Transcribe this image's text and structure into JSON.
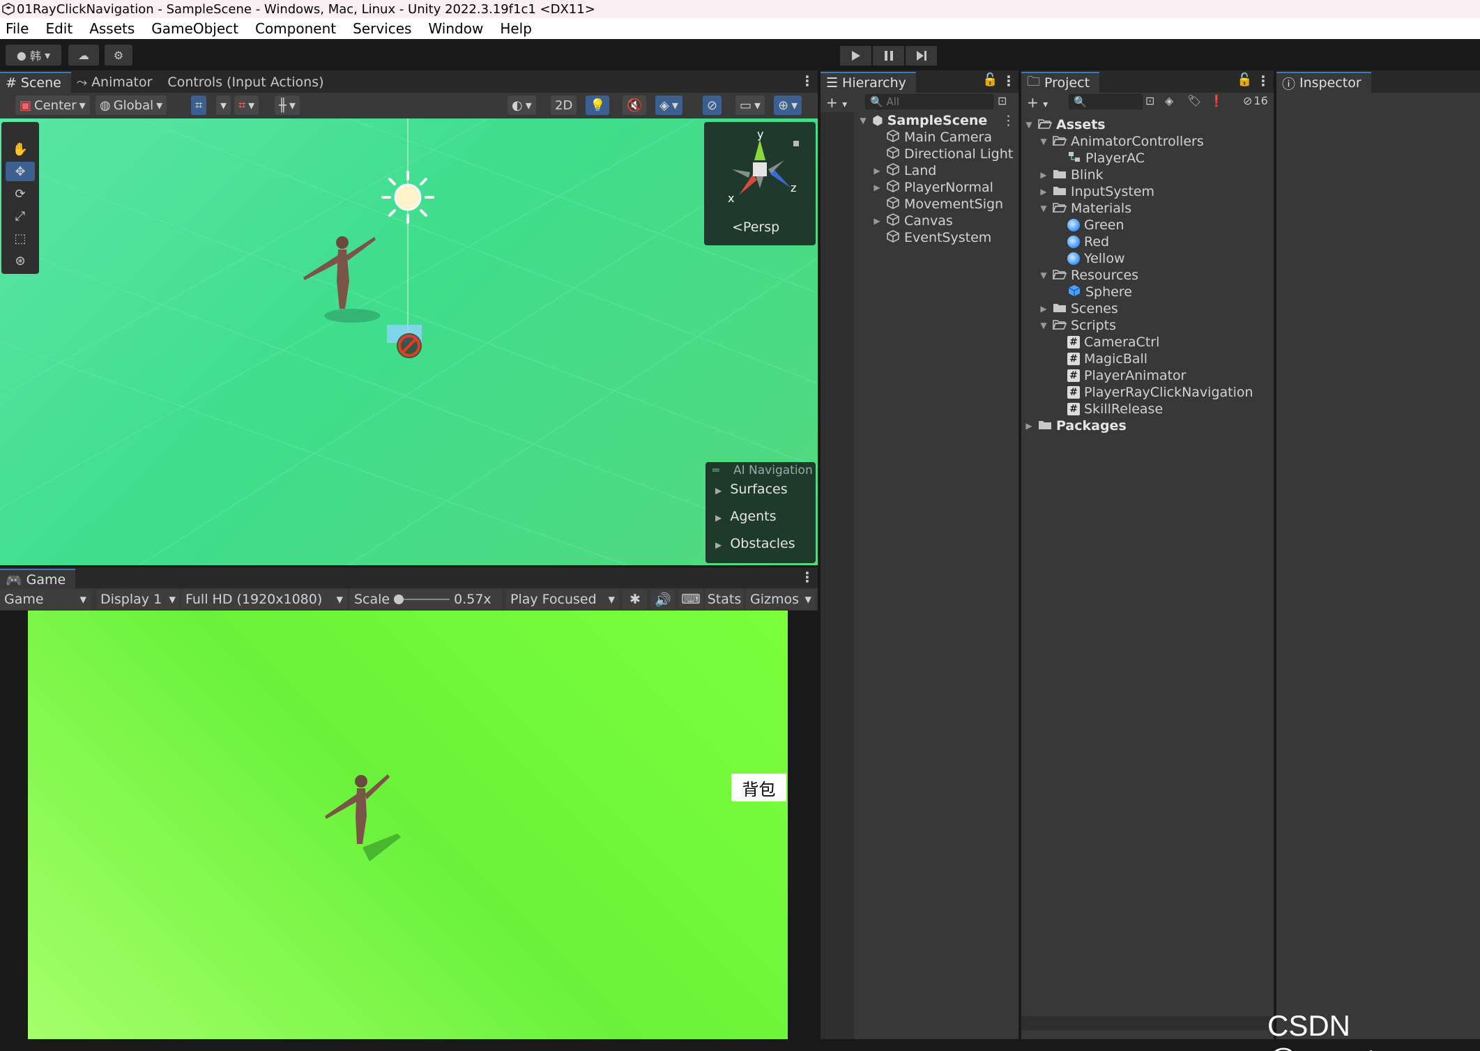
{
  "window": {
    "title": "01RayClickNavigation - SampleScene - Windows, Mac, Linux - Unity 2022.3.19f1c1 <DX11>"
  },
  "menu": [
    "File",
    "Edit",
    "Assets",
    "GameObject",
    "Component",
    "Services",
    "Window",
    "Help"
  ],
  "toolbar": {
    "account_label": "韩"
  },
  "scene_panel": {
    "tabs": [
      "Scene",
      "Animator",
      "Controls (Input Actions)"
    ],
    "pivot_mode": "Center",
    "pivot_space": "Global",
    "mode_2d": "2D",
    "gizmo": {
      "axis_y": "y",
      "axis_x": "x",
      "axis_z": "z",
      "projection": "Persp"
    },
    "ai_navigation": {
      "title": "AI Navigation",
      "items": [
        "Surfaces",
        "Agents",
        "Obstacles"
      ]
    }
  },
  "game_panel": {
    "tab": "Game",
    "view_mode": "Game",
    "display": "Display 1",
    "resolution": "Full HD (1920x1080)",
    "scale_label": "Scale",
    "scale_value": "0.57x",
    "scale_fraction": 0.0,
    "play_mode": "Play Focused",
    "stats": "Stats",
    "gizmos": "Gizmos",
    "bag_button": "背包"
  },
  "hierarchy": {
    "tab": "Hierarchy",
    "search_placeholder": "All",
    "scene": "SampleScene",
    "items": [
      {
        "name": "Main Camera",
        "expandable": false
      },
      {
        "name": "Directional Light",
        "expandable": false
      },
      {
        "name": "Land",
        "expandable": true
      },
      {
        "name": "PlayerNormal",
        "expandable": true
      },
      {
        "name": "MovementSign",
        "expandable": false
      },
      {
        "name": "Canvas",
        "expandable": true
      },
      {
        "name": "EventSystem",
        "expandable": false
      }
    ]
  },
  "project": {
    "tab": "Project",
    "hidden_count": "16",
    "tree": [
      {
        "name": "Assets",
        "depth": 0,
        "type": "folder-open",
        "bold": true,
        "arrow": "down"
      },
      {
        "name": "AnimatorControllers",
        "depth": 1,
        "type": "folder-open",
        "arrow": "down"
      },
      {
        "name": "PlayerAC",
        "depth": 2,
        "type": "animator"
      },
      {
        "name": "Blink",
        "depth": 1,
        "type": "folder",
        "arrow": "right"
      },
      {
        "name": "InputSystem",
        "depth": 1,
        "type": "folder",
        "arrow": "right"
      },
      {
        "name": "Materials",
        "depth": 1,
        "type": "folder-open",
        "arrow": "down"
      },
      {
        "name": "Green",
        "depth": 2,
        "type": "material"
      },
      {
        "name": "Red",
        "depth": 2,
        "type": "material"
      },
      {
        "name": "Yellow",
        "depth": 2,
        "type": "material"
      },
      {
        "name": "Resources",
        "depth": 1,
        "type": "folder-open",
        "arrow": "down"
      },
      {
        "name": "Sphere",
        "depth": 2,
        "type": "prefab"
      },
      {
        "name": "Scenes",
        "depth": 1,
        "type": "folder",
        "arrow": "right"
      },
      {
        "name": "Scripts",
        "depth": 1,
        "type": "folder-open",
        "arrow": "down"
      },
      {
        "name": "CameraCtrl",
        "depth": 2,
        "type": "script"
      },
      {
        "name": "MagicBall",
        "depth": 2,
        "type": "script"
      },
      {
        "name": "PlayerAnimator",
        "depth": 2,
        "type": "script"
      },
      {
        "name": "PlayerRayClickNavigation",
        "depth": 2,
        "type": "script"
      },
      {
        "name": "SkillRelease",
        "depth": 2,
        "type": "script"
      },
      {
        "name": "Packages",
        "depth": 0,
        "type": "folder",
        "bold": true,
        "arrow": "right"
      }
    ]
  },
  "inspector": {
    "tab": "Inspector"
  },
  "watermark": "CSDN @__water",
  "colors": {
    "accent": "#3a79bb",
    "scene_bg": "#44df90",
    "game_bg": "#72f53c",
    "panel": "#383838"
  }
}
